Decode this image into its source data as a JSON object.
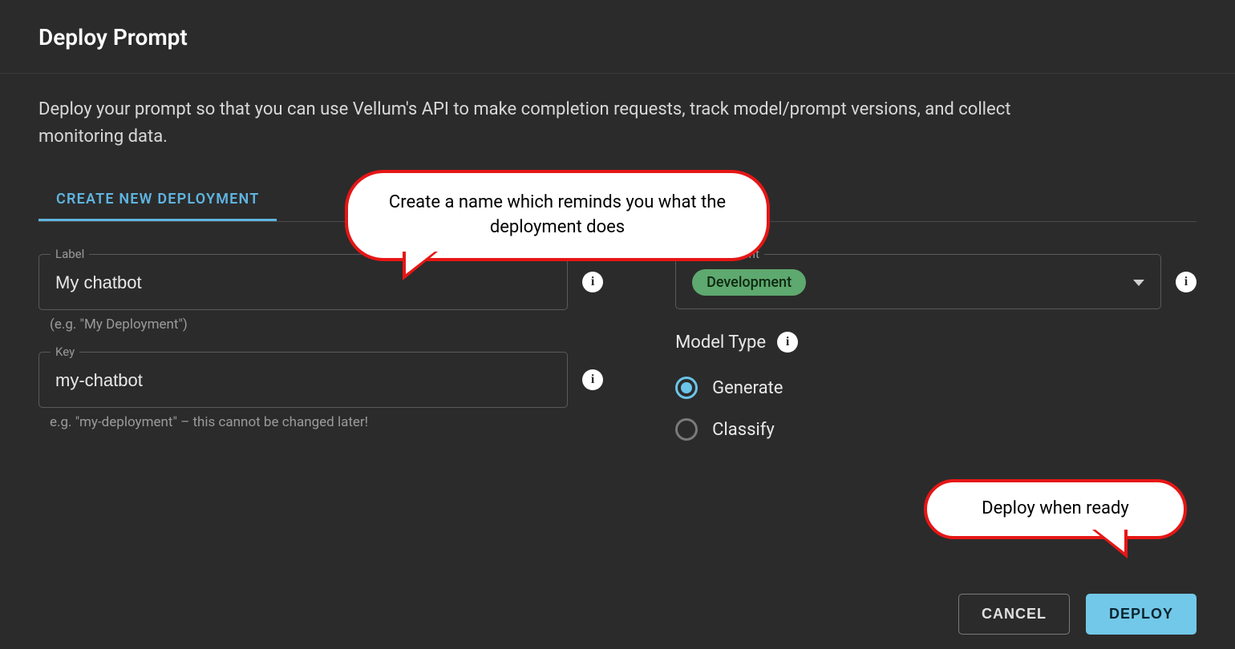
{
  "dialog": {
    "title": "Deploy Prompt",
    "description": "Deploy your prompt so that you can use Vellum's API to make completion requests, track model/prompt versions, and collect monitoring data."
  },
  "tabs": {
    "create": "CREATE NEW DEPLOYMENT"
  },
  "form": {
    "label_field": {
      "label": "Label",
      "value": "My chatbot",
      "helper": "(e.g. \"My Deployment\")"
    },
    "key_field": {
      "label": "Key",
      "value": "my-chatbot",
      "helper": "e.g. \"my-deployment\" – this cannot be changed later!"
    },
    "environment": {
      "label": "Environment",
      "value": "Development"
    },
    "model_type": {
      "label": "Model Type",
      "options": {
        "generate": "Generate",
        "classify": "Classify"
      }
    }
  },
  "callouts": {
    "name_hint": "Create a name which reminds you what the deployment does",
    "deploy_hint": "Deploy when ready"
  },
  "buttons": {
    "cancel": "CANCEL",
    "deploy": "DEPLOY"
  }
}
